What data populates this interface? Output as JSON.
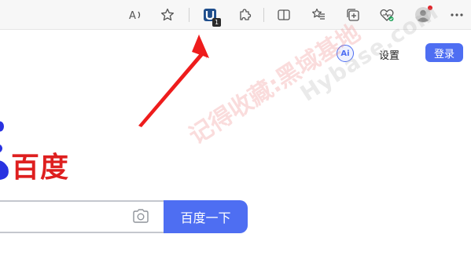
{
  "toolbar": {
    "icons": [
      {
        "name": "read-aloud-icon",
        "glyph": "A⁾"
      },
      {
        "name": "favorite-star-icon"
      },
      {
        "name": "extension-u-icon",
        "badge": "1"
      },
      {
        "name": "extensions-puzzle-icon"
      },
      {
        "name": "split-screen-icon"
      },
      {
        "name": "favorites-list-icon"
      },
      {
        "name": "collections-icon"
      },
      {
        "name": "browser-essentials-icon"
      },
      {
        "name": "profile-avatar-icon"
      },
      {
        "name": "more-menu-icon"
      }
    ],
    "extension_badge": "1"
  },
  "page": {
    "ai_label": "Ai",
    "settings_label": "设置",
    "login_label": "登录",
    "logo_text": "百度",
    "search_button_label": "百度一下",
    "search_value": ""
  },
  "watermark": {
    "cn_text": "记得收藏:黑域基地",
    "en_text": "Hybase.com"
  },
  "colors": {
    "accent": "#4e6ef2",
    "logo_red": "#de1f1f",
    "arrow_red": "#ee1c1c"
  }
}
